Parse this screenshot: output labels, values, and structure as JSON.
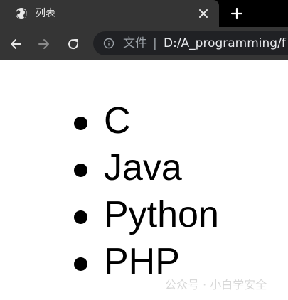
{
  "tab": {
    "title": "列表",
    "favicon_icon": "globe-icon",
    "close_icon": "close-icon"
  },
  "new_tab_icon": "plus-icon",
  "toolbar": {
    "back_icon": "arrow-left-icon",
    "forward_icon": "arrow-right-icon",
    "reload_icon": "reload-icon",
    "info_icon": "info-icon",
    "chip_label": "文件",
    "separator": "|",
    "url": "D:/A_programming/f"
  },
  "list": {
    "items": [
      "C",
      "Java",
      "Python",
      "PHP"
    ]
  },
  "watermark": "公众号 · 小白学安全",
  "colors": {
    "tabbar_bg": "#000000",
    "tab_bg": "#353535",
    "omnibox_bg": "#202124",
    "page_bg": "#ffffff",
    "text": "#000000"
  }
}
